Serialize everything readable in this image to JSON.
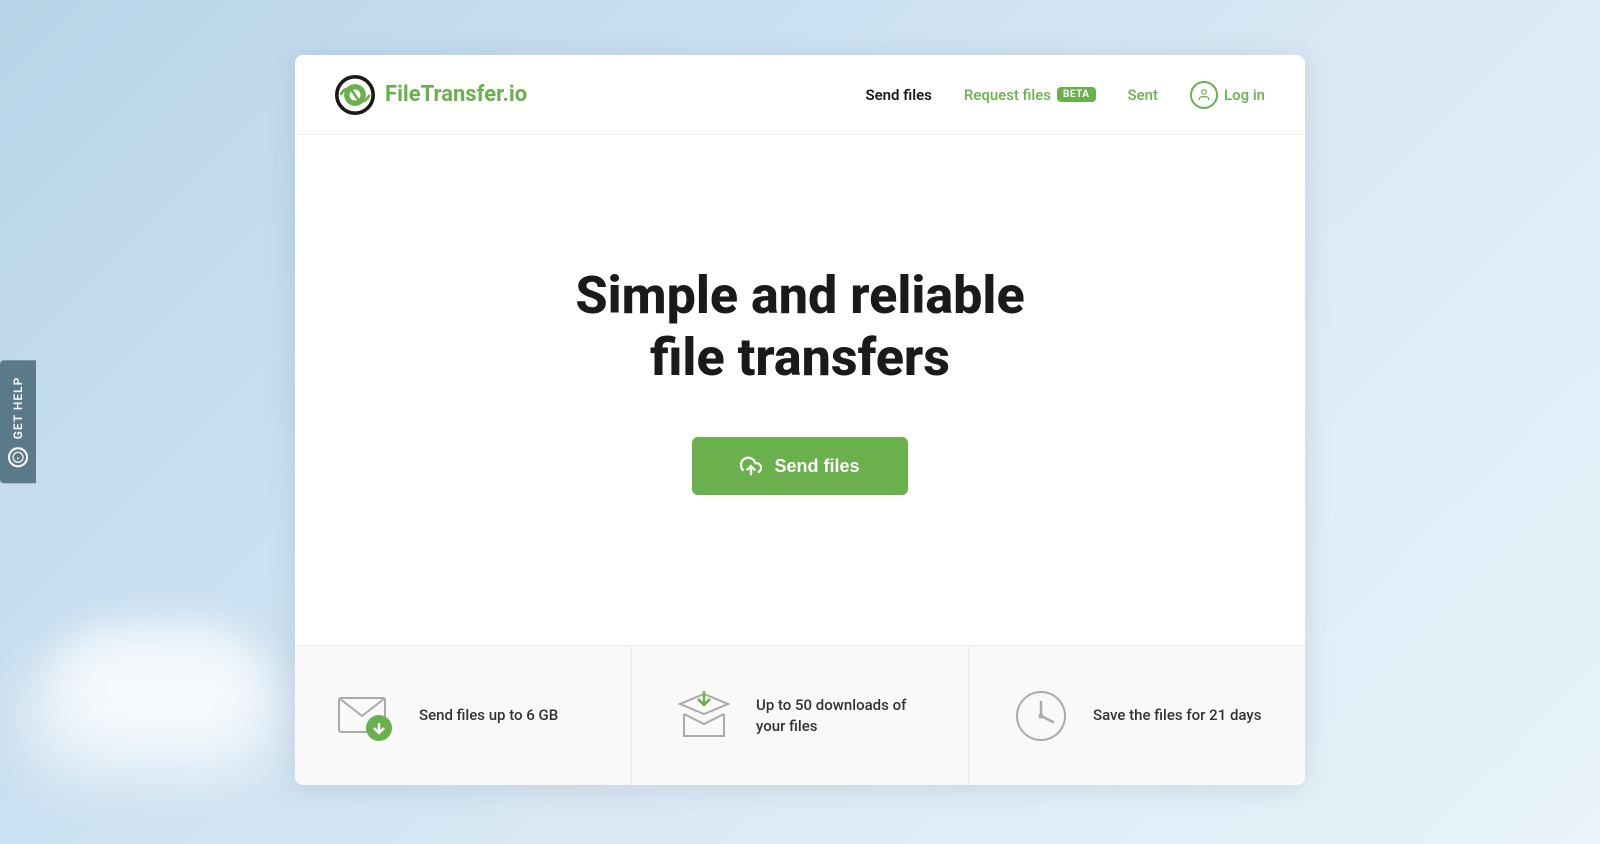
{
  "brand": {
    "name_part1": "FileTransfer",
    "name_part2": ".io",
    "logo_alt": "FileTransfer.io logo"
  },
  "nav": {
    "send_files": "Send files",
    "request_files": "Request files",
    "beta_label": "BETA",
    "sent": "Sent",
    "login": "Log in"
  },
  "hero": {
    "title_line1": "Simple and reliable",
    "title_line2": "file transfers",
    "cta_button": "Send files"
  },
  "features": [
    {
      "icon": "envelope",
      "text": "Send files up to 6 GB"
    },
    {
      "icon": "box-download",
      "text": "Up to 50 downloads of your files"
    },
    {
      "icon": "clock",
      "text": "Save the files for 21 days"
    }
  ],
  "sidebar": {
    "get_help": "GET HELP"
  },
  "colors": {
    "green": "#6ab04c",
    "dark": "#1a1a1a",
    "gray": "#5a7a8a"
  }
}
